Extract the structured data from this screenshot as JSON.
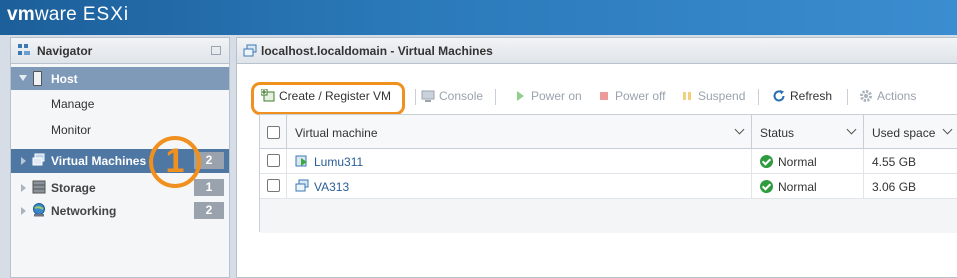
{
  "brand": {
    "vm": "vm",
    "ware": "ware",
    "product": "ESXi"
  },
  "navigator": {
    "title": "Navigator",
    "host": {
      "label": "Host",
      "items": [
        {
          "label": "Manage"
        },
        {
          "label": "Monitor"
        }
      ]
    },
    "items": [
      {
        "label": "Virtual Machines",
        "count": "2",
        "selected": true
      },
      {
        "label": "Storage",
        "count": "1"
      },
      {
        "label": "Networking",
        "count": "2"
      }
    ]
  },
  "callout": {
    "number": "1"
  },
  "main": {
    "title": "localhost.localdomain - Virtual Machines",
    "toolbar": {
      "create": "Create / Register VM",
      "console": "Console",
      "power_on": "Power on",
      "power_off": "Power off",
      "suspend": "Suspend",
      "refresh": "Refresh",
      "actions": "Actions"
    },
    "grid": {
      "columns": [
        "Virtual machine",
        "Status",
        "Used space"
      ],
      "rows": [
        {
          "name": "Lumu311",
          "status": "Normal",
          "used": "4.55 GB"
        },
        {
          "name": "VA313",
          "status": "Normal",
          "used": "3.06 GB"
        }
      ]
    }
  },
  "colors": {
    "accent": "#f0901e",
    "selected": "#4f77a4",
    "status_ok": "#2f9b3e"
  }
}
